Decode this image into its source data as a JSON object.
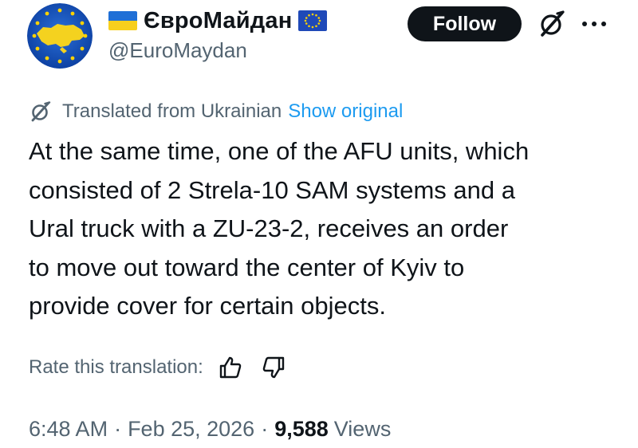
{
  "user": {
    "display_name": "ЄвроМайдан",
    "handle": "@EuroMaydan",
    "avatar_icon": "euromaydan-avatar",
    "name_emoji_left": "ukraine-flag-icon",
    "name_emoji_right": "eu-flag-icon"
  },
  "actions": {
    "follow_label": "Follow",
    "grok_icon": "grok-icon",
    "more_icon": "more-icon"
  },
  "translation": {
    "notice": "Translated from Ukrainian",
    "show_original": "Show original",
    "rate_label": "Rate this translation:",
    "thumbs_up_icon": "thumbs-up-icon",
    "thumbs_down_icon": "thumbs-down-icon"
  },
  "tweet": {
    "lines": [
      "At the same time, one of the AFU units, which",
      "consisted of 2 Strela-10 SAM systems and a",
      "Ural truck with a ZU-23-2, receives an order",
      "to move out toward the center of Kyiv to",
      "provide cover for certain objects."
    ]
  },
  "meta": {
    "time": "6:48 AM",
    "separator": "·",
    "date": "Feb 25, 2026",
    "views_count": "9,588",
    "views_label": "Views"
  },
  "colors": {
    "text": "#0f1419",
    "secondary": "#536471",
    "link": "#1d9bf0",
    "button_bg": "#0f1419",
    "button_text": "#ffffff"
  }
}
